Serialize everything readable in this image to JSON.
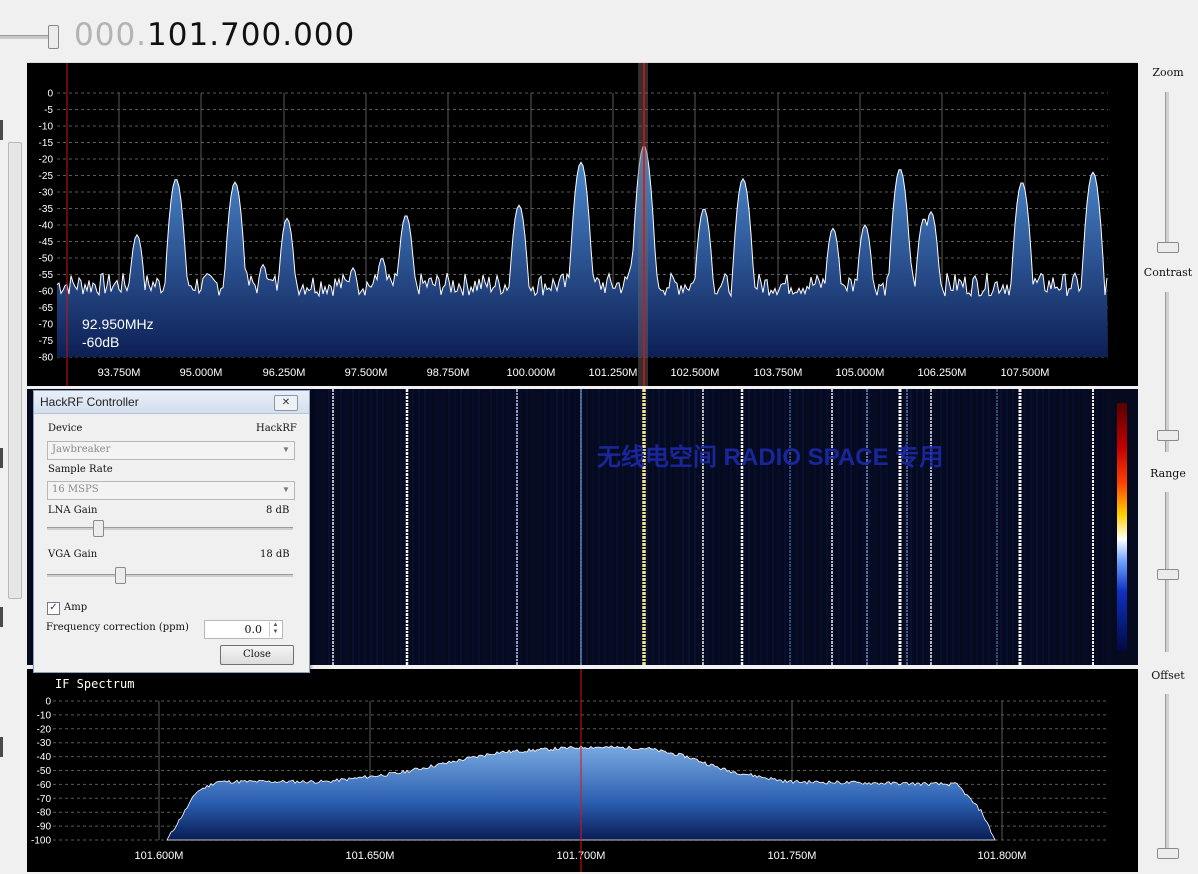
{
  "frequency": {
    "dim_part": "000.",
    "bright_part": "101.700.000"
  },
  "main_spectrum": {
    "y_ticks": [
      "0",
      "-5",
      "-10",
      "-15",
      "-20",
      "-25",
      "-30",
      "-35",
      "-40",
      "-45",
      "-50",
      "-55",
      "-60",
      "-65",
      "-70",
      "-75",
      "-80"
    ],
    "x_ticks": [
      "93.750M",
      "95.000M",
      "96.250M",
      "97.500M",
      "98.750M",
      "100.000M",
      "101.250M",
      "102.500M",
      "103.750M",
      "105.000M",
      "106.250M",
      "107.500M"
    ],
    "mouse_freq": "92.950MHz",
    "mouse_level": "-60dB"
  },
  "waterfall": {
    "watermark": "无线电空间 RADIO SPACE 专用"
  },
  "if_spectrum": {
    "title": "IF Spectrum",
    "y_ticks": [
      "0",
      "-10",
      "-20",
      "-30",
      "-40",
      "-50",
      "-60",
      "-70",
      "-80",
      "-90",
      "-100"
    ],
    "x_ticks": [
      "101.600M",
      "101.650M",
      "101.700M",
      "101.750M",
      "101.800M"
    ]
  },
  "right_controls": {
    "zoom": "Zoom",
    "contrast": "Contrast",
    "range": "Range",
    "offset": "Offset"
  },
  "dialog": {
    "title": "HackRF Controller",
    "device_label": "Device",
    "device_type": "HackRF",
    "device_value": "Jawbreaker",
    "sample_rate_label": "Sample Rate",
    "sample_rate_value": "16 MSPS",
    "lna_label": "LNA Gain",
    "lna_value": "8 dB",
    "vga_label": "VGA Gain",
    "vga_value": "18 dB",
    "amp_label": "Amp",
    "amp_checked": true,
    "ppm_label": "Frequency correction (ppm)",
    "ppm_value": "0.0",
    "close_label": "Close"
  },
  "colors": {
    "spectrum_fill": "#1e4f9a",
    "marker": "#e01010",
    "background": "#000000"
  }
}
